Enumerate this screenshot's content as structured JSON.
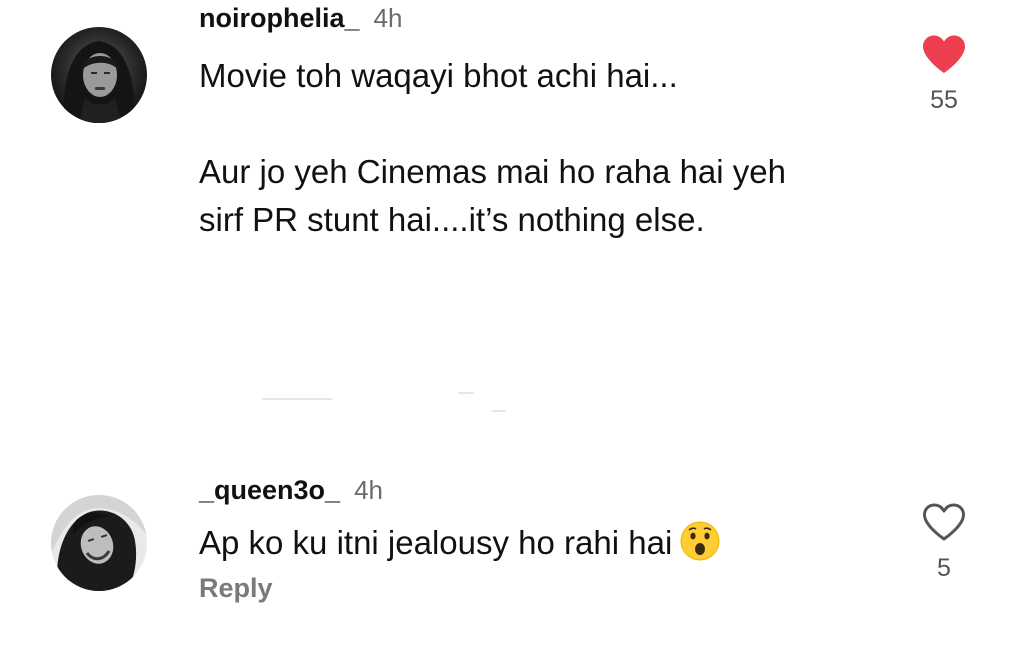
{
  "comments": [
    {
      "username": "noirophelia_",
      "time": "4h",
      "body": "Movie toh waqayi bhot achi hai...\n\nAur jo yeh Cinemas mai ho raha hai yeh sirf PR stunt hai....it’s nothing else.",
      "likes": "55",
      "liked": true,
      "heart_icon": "heart-filled-icon",
      "heart_color": "#ed3f4f"
    },
    {
      "username": "_queen3o_",
      "time": "4h",
      "body": "Ap ko ku itni jealousy ho rahi hai",
      "emoji_icon": "astonished-face-emoji",
      "reply_label": "Reply",
      "likes": "5",
      "liked": false,
      "heart_icon": "heart-outline-icon"
    }
  ]
}
